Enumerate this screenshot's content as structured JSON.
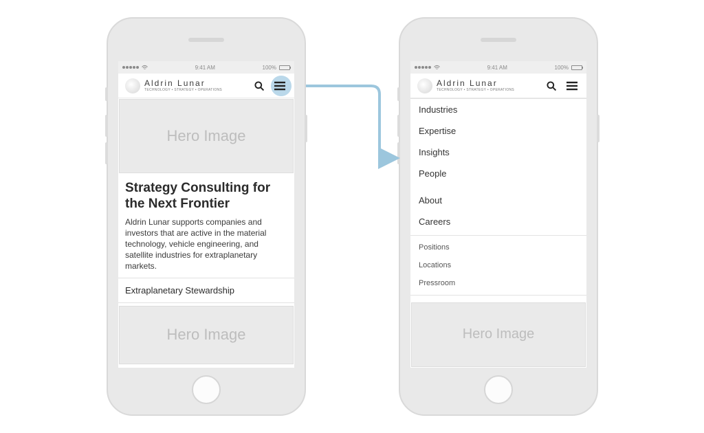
{
  "status_bar": {
    "time": "9:41 AM",
    "battery_pct": "100%"
  },
  "brand": {
    "name": "Aldrin Lunar",
    "tagline": "TECHNOLOGY • STRATEGY • OPERATIONS"
  },
  "hero_label": "Hero Image",
  "left_screen": {
    "headline": "Strategy Consulting for the Next Frontier",
    "body": "Aldrin Lunar supports companies and investors that are active in the material technology, vehicle engineering, and satellite industries for extraplanetary markets.",
    "link_row": "Extraplanetary Stewardship"
  },
  "nav": {
    "primary": [
      "Industries",
      "Expertise",
      "Insights",
      "People",
      "About",
      "Careers"
    ],
    "secondary": [
      "Positions",
      "Locations",
      "Pressroom"
    ]
  }
}
